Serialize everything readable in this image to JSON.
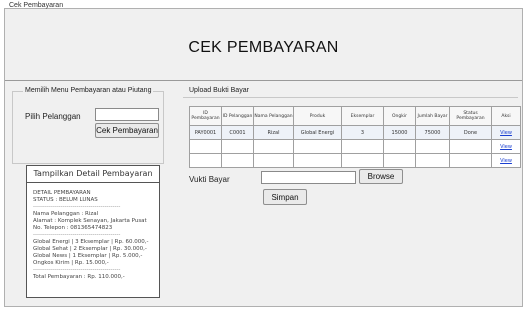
{
  "window": {
    "title": "Cek Pembayaran"
  },
  "header": {
    "title": "CEK PEMBAYARAN"
  },
  "left_panel": {
    "section_title": "Memilih Menu Pembayaran atau Piutang",
    "pelanggan_label": "Pilih Pelanggan",
    "pelanggan_value": "",
    "cek_button": "Cek Pembayaran"
  },
  "detail": {
    "header": "Tampilkan Detail Pembayaran",
    "lines": [
      "DETAIL PEMBAYARAN",
      "STATUS : BELUM LUNAS",
      "--------------------------------------------",
      "Nama Pelanggan : Rizal",
      "Alamat : Komplek Senayan, Jakarta Pusat",
      "No. Telepon : 081365474823",
      "--------------------------------------------",
      "Global Energi | 3 Eksemplar | Rp. 60.000,-",
      "Global Sehat | 2 Eksemplar | Rp. 30.000,-",
      "Global News | 1 Eksemplar | Rp. 5.000,-",
      "Ongkos Kirim | Rp. 15.000,-",
      "--------------------------------------------",
      "Total Pembayaran : Rp. 110.000,-"
    ]
  },
  "upload": {
    "section_title": "Upload Bukti Bayar",
    "columns": [
      "ID Pembayaran",
      "ID Pelanggan",
      "Nama Pelanggan",
      "Produk",
      "Eksemplar",
      "Ongkir",
      "Jumlah Bayar",
      "Status Pembayaran",
      "Aksi"
    ],
    "rows": [
      [
        "PAY0001",
        "C0001",
        "Rizal",
        "Global Energi",
        "3",
        "15000",
        "75000",
        "Done",
        "View"
      ],
      [
        "",
        "",
        "",
        "",
        "",
        "",
        "",
        "",
        "View"
      ],
      [
        "",
        "",
        "",
        "",
        "",
        "",
        "",
        "",
        "View"
      ]
    ],
    "vukti_label": "Vukti Bayar",
    "vukti_value": "",
    "browse_button": "Browse",
    "simpan_button": "Simpan"
  }
}
